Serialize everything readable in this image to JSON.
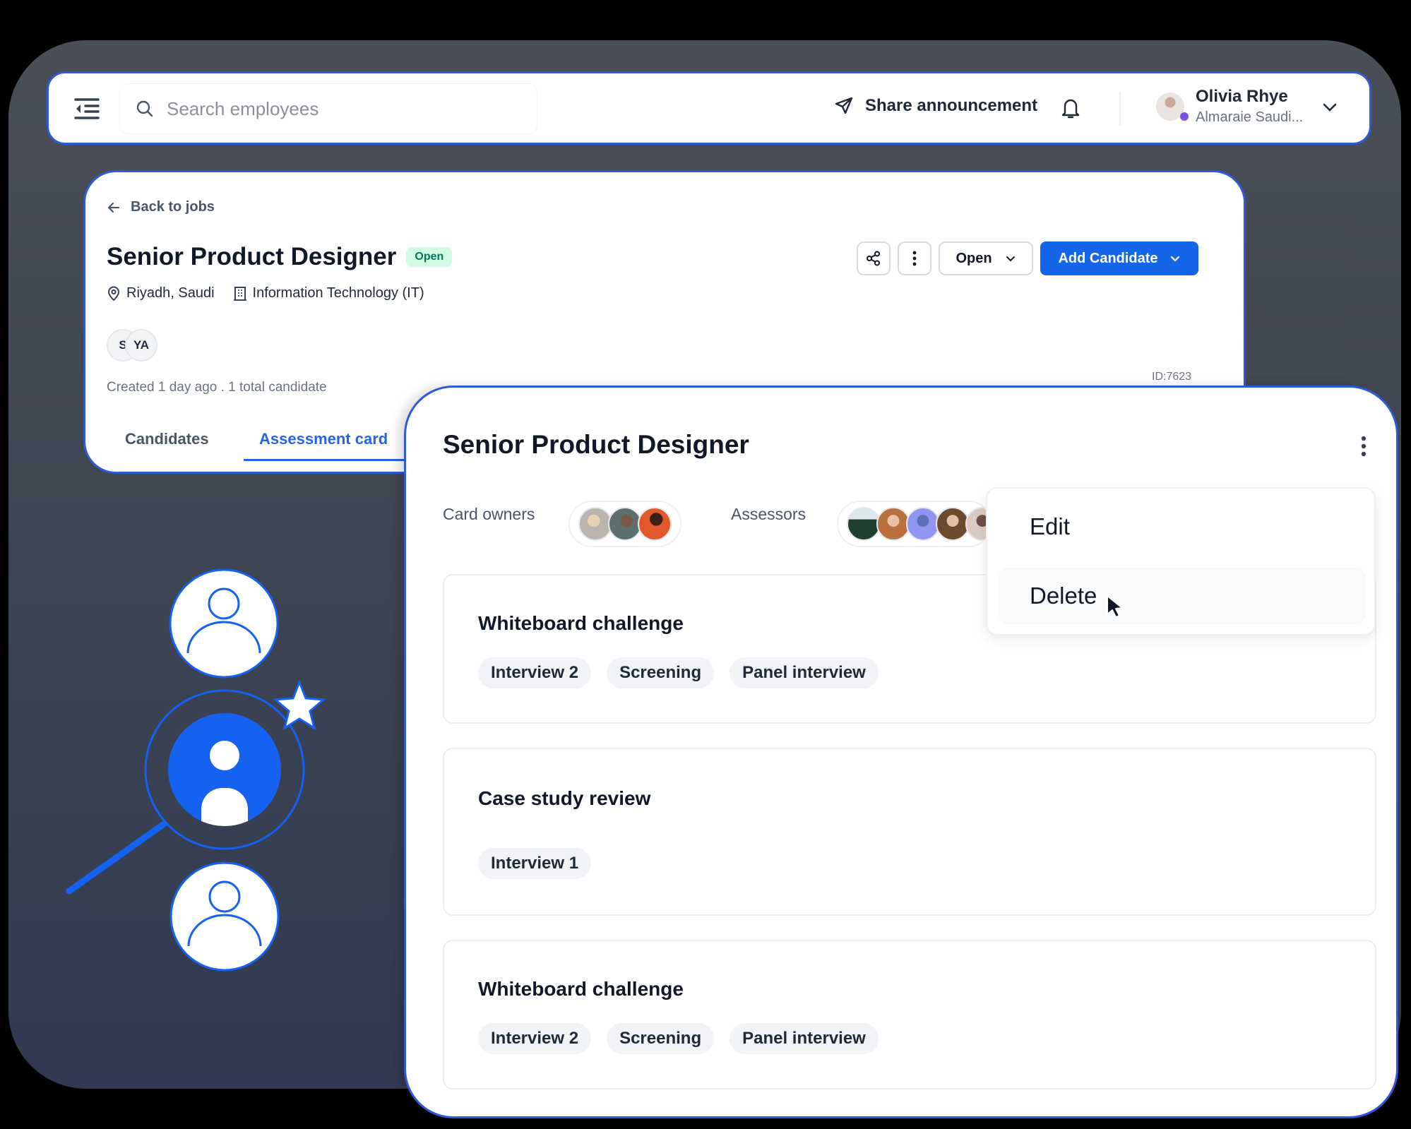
{
  "topbar": {
    "menu_icon": "sidebar-collapse-icon",
    "search": {
      "placeholder": "Search employees",
      "value": "",
      "icon": "search-icon"
    },
    "share_label": "Share announcement",
    "share_icon": "send-icon",
    "bell_icon": "bell-icon",
    "user": {
      "name": "Olivia Rhye",
      "org": "Almaraie Saudi...",
      "status_color": "#7b4ee4"
    }
  },
  "job": {
    "back_label": "Back to jobs",
    "title": "Senior Product Designer",
    "status_badge": "Open",
    "location": "Riyadh, Saudi",
    "department": "Information Technology (IT)",
    "members": [
      "S",
      "YA"
    ],
    "created_text": "Created 1 day ago . 1 total candidate",
    "id_text": "ID:7623",
    "actions": {
      "status_select": "Open",
      "add_candidate": "Add Candidate"
    },
    "tabs": [
      {
        "label": "Candidates",
        "active": false
      },
      {
        "label": "Assessment card",
        "active": true
      }
    ]
  },
  "assessment": {
    "title": "Senior Product Designer",
    "owners_label": "Card owners",
    "assessors_label": "Assessors",
    "owners_count_visible": 3,
    "assessors_count_visible": 5,
    "steps": [
      {
        "title": "Whiteboard challenge",
        "tags": [
          "Interview 2",
          "Screening",
          "Panel interview"
        ]
      },
      {
        "title": "Case study review",
        "tags": [
          "Interview 1"
        ]
      },
      {
        "title": "Whiteboard challenge",
        "tags": [
          "Interview 2",
          "Screening",
          "Panel interview"
        ]
      }
    ],
    "menu": {
      "items": [
        "Edit",
        "Delete"
      ],
      "hovered": "Delete"
    }
  },
  "colors": {
    "accent": "#1565e8",
    "border_blue": "#2d5bd7",
    "badge_green_bg": "#d1fae5",
    "badge_green_text": "#047857"
  }
}
